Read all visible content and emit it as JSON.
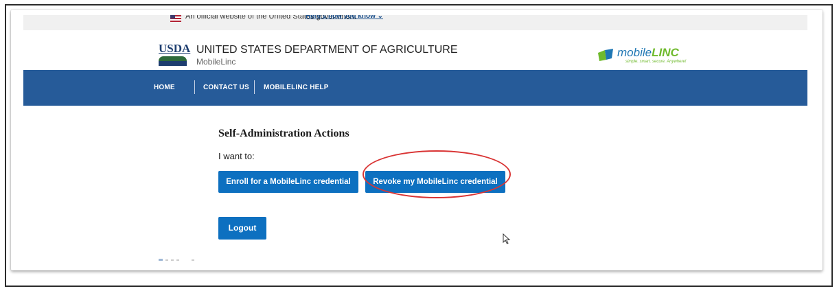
{
  "gov_banner": {
    "text": "An official website of the United States government",
    "link": "Here's how you know"
  },
  "header": {
    "logo_text": "USDA",
    "agency": "UNITED STATES DEPARTMENT OF AGRICULTURE",
    "subagency": "MobileLinc",
    "app_logo": {
      "name_part1": "mobile",
      "name_part2": "LINC",
      "tagline": "simple. smart. secure. Anywhere!"
    }
  },
  "nav": {
    "items": [
      {
        "label": "HOME"
      },
      {
        "label": "CONTACT US"
      },
      {
        "label": "MOBILELINC HELP"
      }
    ]
  },
  "main": {
    "heading": "Self-Administration Actions",
    "prompt": "I want to:",
    "enroll_button": "Enroll for a MobileLinc credential",
    "revoke_button": "Revoke my MobileLinc credential",
    "logout_button": "Logout"
  },
  "colors": {
    "nav_bg": "#265b99",
    "button_bg": "#0d70c0",
    "highlight": "#d93434"
  }
}
